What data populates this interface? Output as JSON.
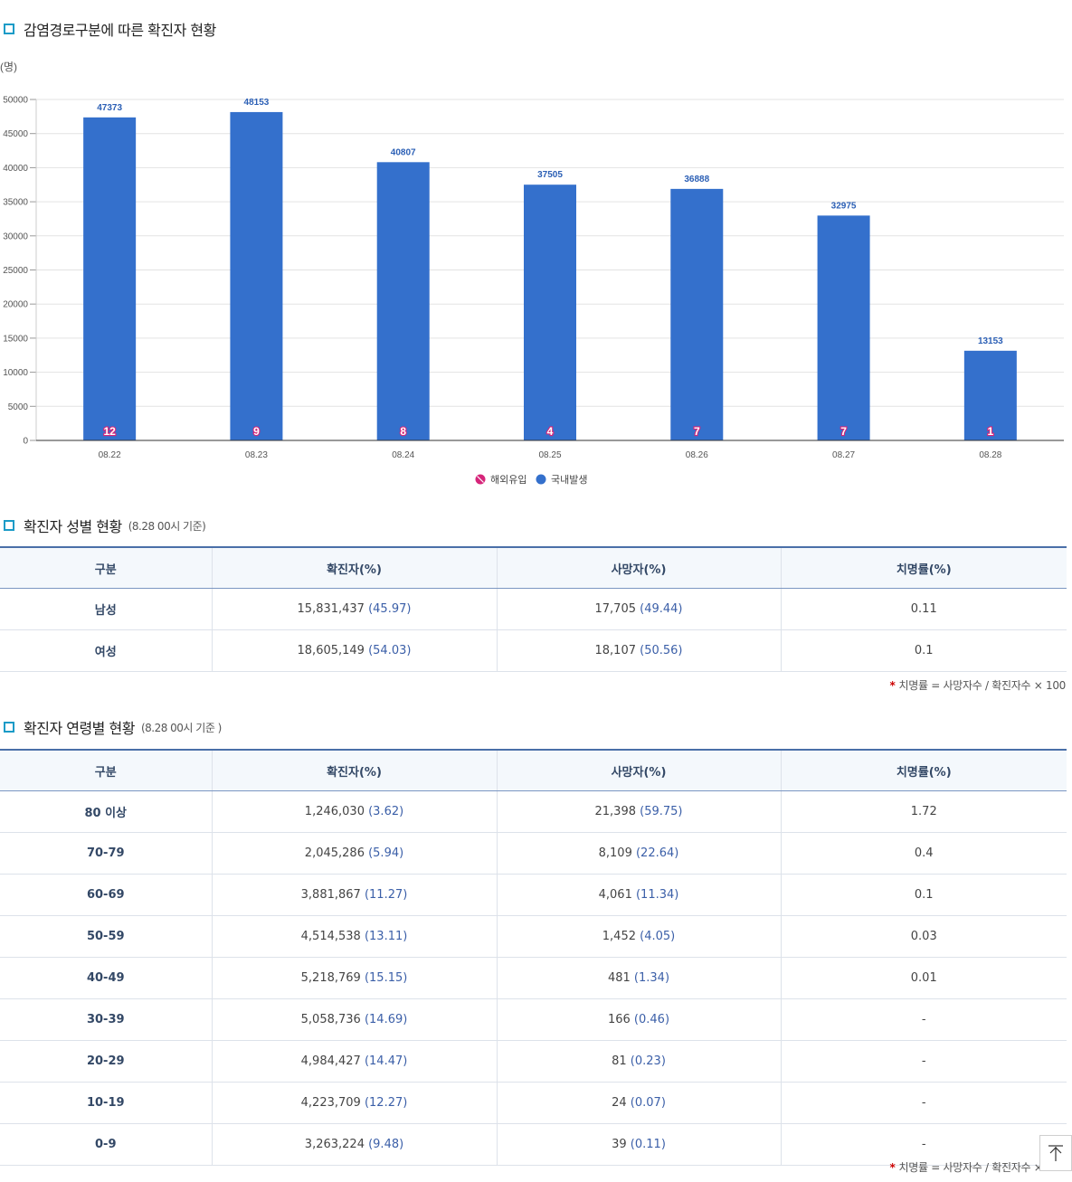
{
  "chart_section": {
    "title": "감염경로구분에 따른 확진자 현황",
    "unit": "(명)"
  },
  "chart_data": {
    "type": "bar",
    "categories": [
      "08.22",
      "08.23",
      "08.24",
      "08.25",
      "08.26",
      "08.27",
      "08.28"
    ],
    "series": [
      {
        "name": "국내발생",
        "values": [
          47373,
          48153,
          40807,
          37505,
          36888,
          32975,
          13153
        ],
        "color": "#3470cc"
      },
      {
        "name": "해외유입",
        "values": [
          12,
          9,
          8,
          4,
          7,
          7,
          1
        ],
        "color": "#d6257a"
      }
    ],
    "yticks": [
      0,
      5000,
      10000,
      15000,
      20000,
      25000,
      30000,
      35000,
      40000,
      45000,
      50000
    ],
    "ylim": [
      0,
      50000
    ],
    "grid": true,
    "legend_position": "bottom-center",
    "legend": [
      "해외유입",
      "국내발생"
    ]
  },
  "gender_section": {
    "title": "확진자 성별 현황",
    "subtitle": "(8.28 00시 기준)",
    "headers": [
      "구분",
      "확진자(%)",
      "사망자(%)",
      "치명률(%)"
    ],
    "rows": [
      {
        "label": "남성",
        "cases": "15,831,437",
        "cases_pct": "(45.97)",
        "deaths": "17,705",
        "deaths_pct": "(49.44)",
        "rate": "0.11"
      },
      {
        "label": "여성",
        "cases": "18,605,149",
        "cases_pct": "(54.03)",
        "deaths": "18,107",
        "deaths_pct": "(50.56)",
        "rate": "0.1"
      }
    ],
    "note_star": "*",
    "note": "치명률 = 사망자수 / 확진자수 × 100"
  },
  "age_section": {
    "title": "확진자 연령별 현황",
    "subtitle": "(8.28 00시 기준 )",
    "headers": [
      "구분",
      "확진자(%)",
      "사망자(%)",
      "치명률(%)"
    ],
    "rows": [
      {
        "label": "80 이상",
        "cases": "1,246,030",
        "cases_pct": "(3.62)",
        "deaths": "21,398",
        "deaths_pct": "(59.75)",
        "rate": "1.72"
      },
      {
        "label": "70-79",
        "cases": "2,045,286",
        "cases_pct": "(5.94)",
        "deaths": "8,109",
        "deaths_pct": "(22.64)",
        "rate": "0.4"
      },
      {
        "label": "60-69",
        "cases": "3,881,867",
        "cases_pct": "(11.27)",
        "deaths": "4,061",
        "deaths_pct": "(11.34)",
        "rate": "0.1"
      },
      {
        "label": "50-59",
        "cases": "4,514,538",
        "cases_pct": "(13.11)",
        "deaths": "1,452",
        "deaths_pct": "(4.05)",
        "rate": "0.03"
      },
      {
        "label": "40-49",
        "cases": "5,218,769",
        "cases_pct": "(15.15)",
        "deaths": "481",
        "deaths_pct": "(1.34)",
        "rate": "0.01"
      },
      {
        "label": "30-39",
        "cases": "5,058,736",
        "cases_pct": "(14.69)",
        "deaths": "166",
        "deaths_pct": "(0.46)",
        "rate": "-"
      },
      {
        "label": "20-29",
        "cases": "4,984,427",
        "cases_pct": "(14.47)",
        "deaths": "81",
        "deaths_pct": "(0.23)",
        "rate": "-"
      },
      {
        "label": "10-19",
        "cases": "4,223,709",
        "cases_pct": "(12.27)",
        "deaths": "24",
        "deaths_pct": "(0.07)",
        "rate": "-"
      },
      {
        "label": "0-9",
        "cases": "3,263,224",
        "cases_pct": "(9.48)",
        "deaths": "39",
        "deaths_pct": "(0.11)",
        "rate": "-"
      }
    ],
    "note_star": "*",
    "note": "치명률 = 사망자수 / 확진자수 × 100"
  },
  "scroll_top_icon": "arrow-to-top-icon"
}
